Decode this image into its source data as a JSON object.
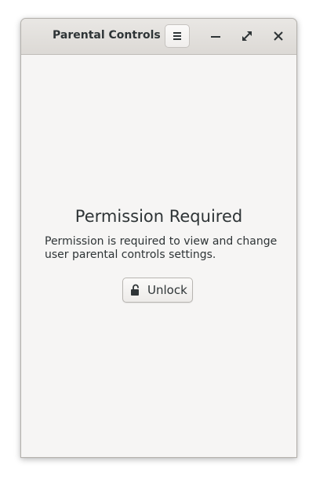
{
  "window": {
    "title": "Parental Controls",
    "controls": {
      "menu": "open-menu-icon",
      "minimize": "minimize-icon",
      "maximize": "maximize-icon",
      "close": "close-icon"
    }
  },
  "main": {
    "heading": "Permission Required",
    "description": "Permission is required to view and change user parental controls settings.",
    "unlock_button": {
      "label": "Unlock",
      "icon": "padlock-unlocked-icon"
    }
  },
  "colors": {
    "text": "#2e3436",
    "background": "#f6f5f4",
    "headerbar": "#dedbd7"
  }
}
